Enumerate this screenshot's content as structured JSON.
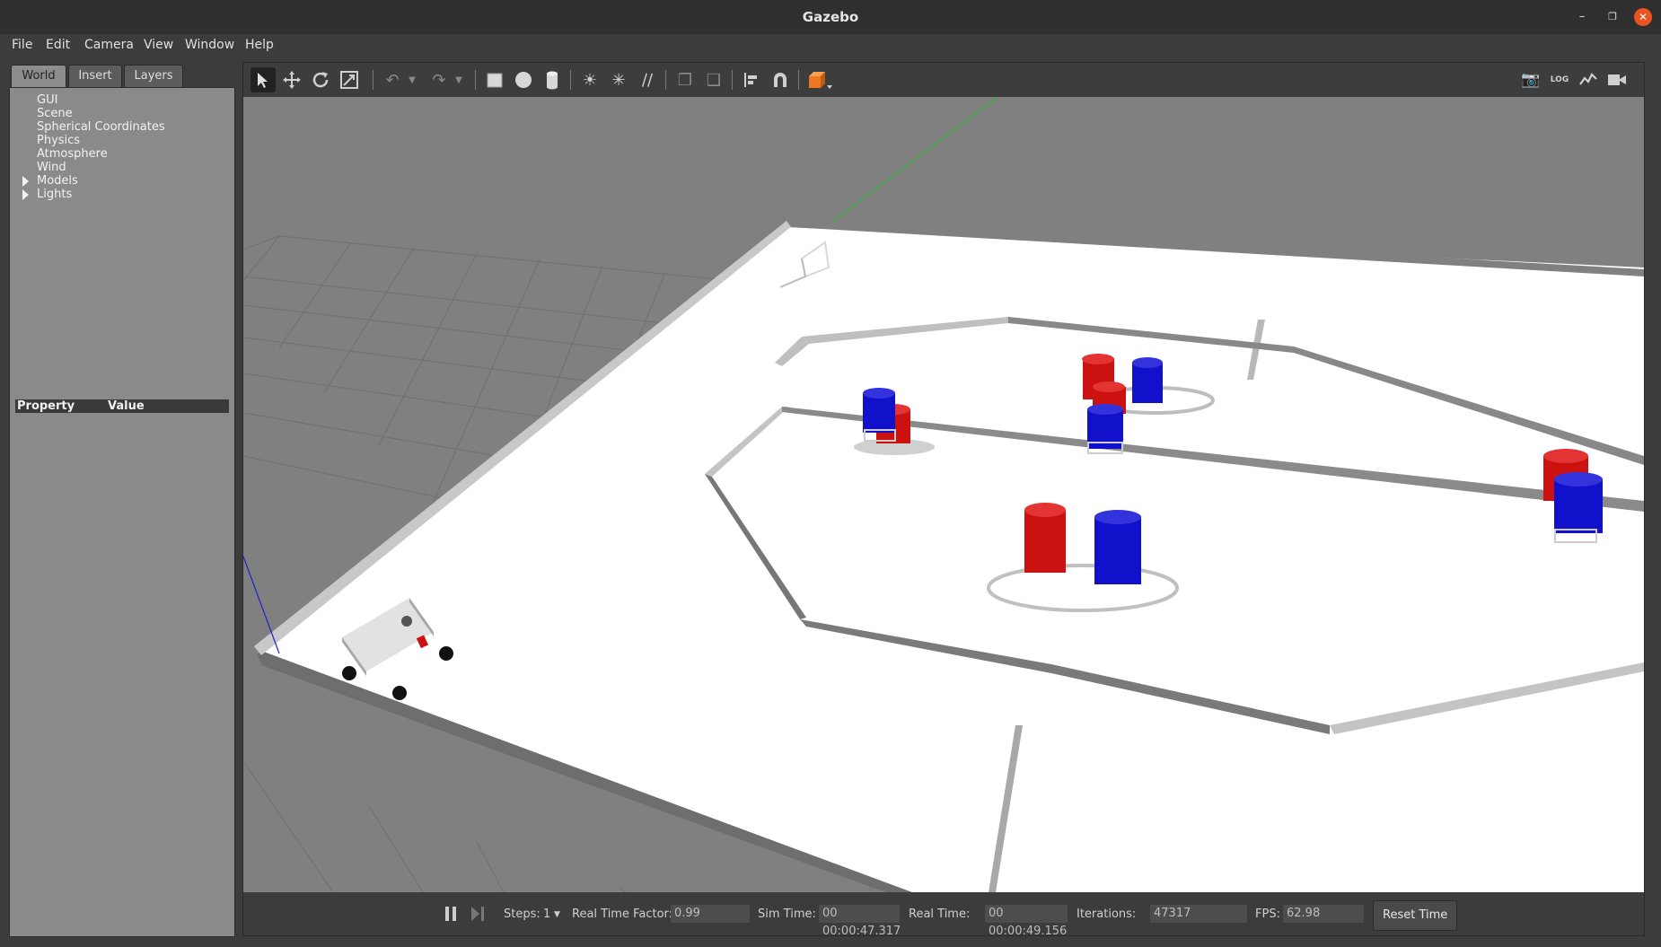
{
  "window": {
    "title": "Gazebo"
  },
  "menu": [
    "File",
    "Edit",
    "Camera",
    "View",
    "Window",
    "Help"
  ],
  "left_panel": {
    "tabs": [
      "World",
      "Insert",
      "Layers"
    ],
    "tree": [
      "GUI",
      "Scene",
      "Spherical Coordinates",
      "Physics",
      "Atmosphere",
      "Wind",
      "Models",
      "Lights"
    ],
    "property_header": {
      "property": "Property",
      "value": "Value"
    }
  },
  "toolbar": {
    "icons": [
      "select-arrow-icon",
      "translate-icon",
      "rotate-icon",
      "scale-icon",
      "undo-icon",
      "redo-icon",
      "box-icon",
      "sphere-icon",
      "cylinder-icon",
      "point-light-icon",
      "spot-light-icon",
      "directional-light-icon",
      "copy-icon",
      "paste-icon",
      "align-icon",
      "snap-icon",
      "change-view-icon",
      "screenshot-icon",
      "log-icon",
      "plot-icon",
      "video-icon"
    ]
  },
  "bottom": {
    "steps_label": "Steps:",
    "steps_value": "1",
    "rtf_label": "Real Time Factor:",
    "rtf_value": "0.99",
    "sim_time_label": "Sim Time:",
    "sim_time_value": "00 00:00:47.317",
    "real_time_label": "Real Time:",
    "real_time_value": "00 00:00:49.156",
    "iterations_label": "Iterations:",
    "iterations_value": "47317",
    "fps_label": "FPS:",
    "fps_value": "62.98",
    "reset_label": "Reset Time"
  },
  "colors": {
    "red_bucket": "#cc1111",
    "blue_bucket": "#1111cc",
    "ground": "#808080",
    "arena_floor": "#ffffff",
    "close_button": "#e95420"
  }
}
